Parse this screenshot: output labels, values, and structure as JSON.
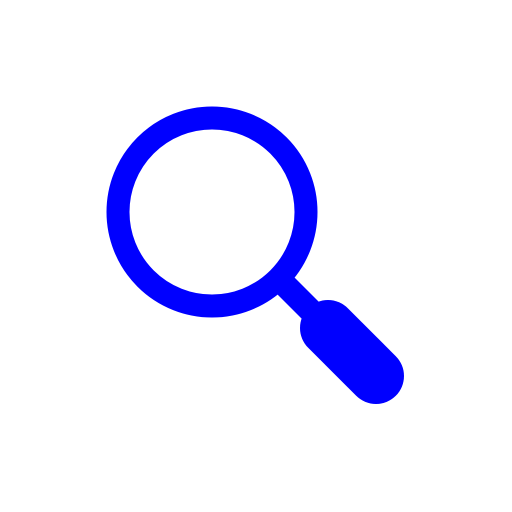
{
  "icon": {
    "name": "search-icon",
    "color": "#0000FF",
    "background": "#FFFFFF"
  }
}
